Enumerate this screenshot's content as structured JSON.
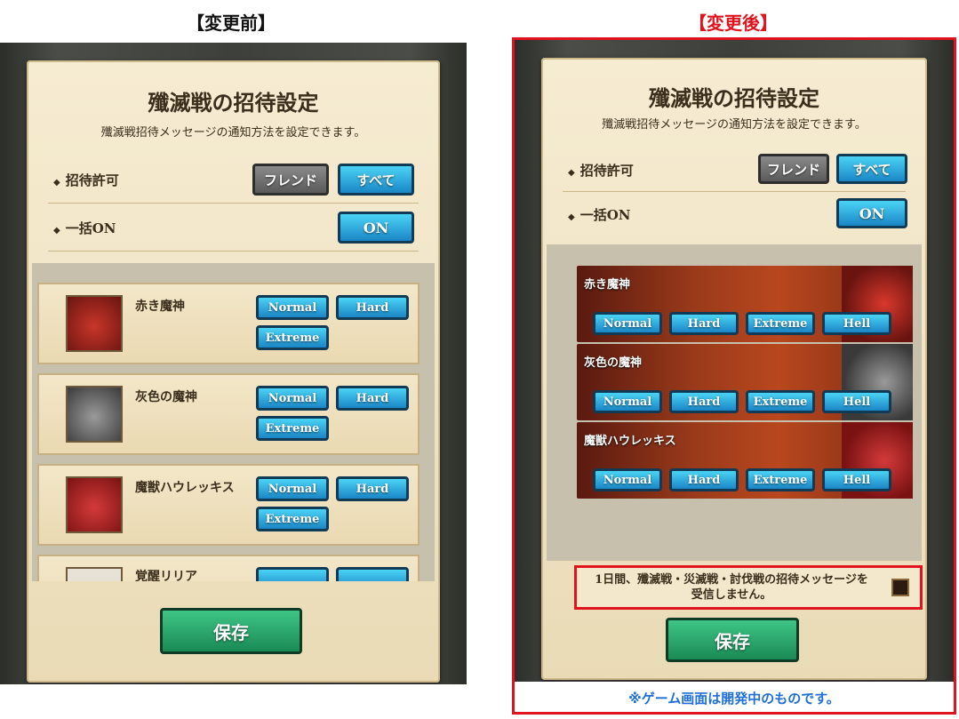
{
  "captions": {
    "before": "【変更前】",
    "after": "【変更後】"
  },
  "dialog": {
    "title": "殲滅戦の招待設定",
    "subtitle": "殲滅戦招待メッセージの通知方法を設定できます。",
    "invite_permission_label": "招待許可",
    "friend_label": "フレンド",
    "all_label": "すべて",
    "bulk_on_label": "一括ON",
    "on_label": "ON",
    "save_label": "保存"
  },
  "difficulties": {
    "normal": "Normal",
    "hard": "Hard",
    "extreme": "Extreme",
    "hell": "Hell"
  },
  "bosses": [
    {
      "name": "赤き魔神"
    },
    {
      "name": "灰色の魔神"
    },
    {
      "name": "魔獣ハウレッキス"
    },
    {
      "name": "覚醒リリア"
    }
  ],
  "notice": {
    "text": "1日間、殲滅戦・災滅戦・討伐戦の招待メッセージを受信しません。"
  },
  "footer_note": "※ゲーム画面は開発中のものです。",
  "colors": {
    "accent_red": "#e0141e",
    "note_blue": "#1f6fd6"
  }
}
